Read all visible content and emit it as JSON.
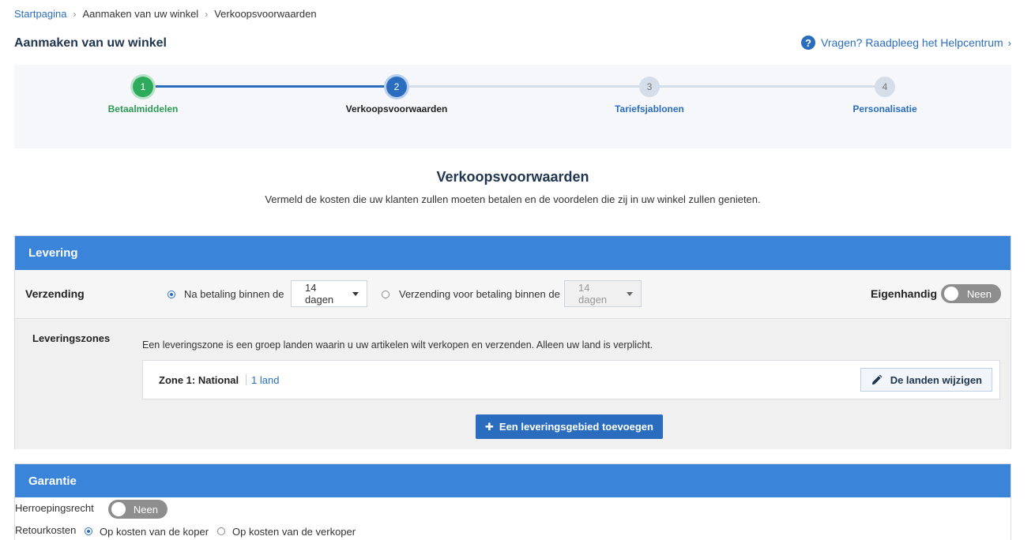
{
  "breadcrumb": {
    "home": "Startpagina",
    "sep": "›",
    "middle": "Aanmaken van uw winkel",
    "current": "Verkoopsvoorwaarden"
  },
  "header": {
    "title": "Aanmaken van uw winkel",
    "help_text": "Vragen? Raadpleeg het Helpcentrum",
    "help_icon_glyph": "?",
    "help_chevron": "›"
  },
  "stepper": {
    "steps": [
      {
        "number": "1",
        "label": "Betaalmiddelen",
        "state": "completed"
      },
      {
        "number": "2",
        "label": "Verkoopsvoorwaarden",
        "state": "active"
      },
      {
        "number": "3",
        "label": "Tariefsjablonen",
        "state": "pending"
      },
      {
        "number": "4",
        "label": "Personalisatie",
        "state": "pending"
      }
    ]
  },
  "intro": {
    "title": "Verkoopsvoorwaarden",
    "subtitle": "Vermeld de kosten die uw klanten zullen moeten betalen en de voordelen die zij in uw winkel zullen genieten."
  },
  "levering": {
    "header": "Levering",
    "verzending": {
      "label": "Verzending",
      "option1_label": "Na betaling binnen de",
      "option1_value": "14 dagen",
      "option1_selected": true,
      "option2_label": "Verzending voor betaling binnen de",
      "option2_value": "14 dagen",
      "option2_selected": false
    },
    "eigenhandig": {
      "label": "Eigenhandig",
      "toggle_text": "Neen",
      "enabled": false
    },
    "zones": {
      "label": "Leveringszones",
      "description": "Een leveringszone is een groep landen waarin u uw artikelen wilt verkopen en verzenden. Alleen uw land is verplicht.",
      "zone_name": "Zone 1: National",
      "zone_count": "1 land",
      "edit_button": "De landen wijzigen",
      "add_button": "Een leveringsgebied toevoegen",
      "add_glyph": "✚"
    }
  },
  "garantie": {
    "header": "Garantie",
    "herroeping": {
      "label": "Herroepingsrecht",
      "toggle_text": "Neen",
      "enabled": false
    },
    "retour": {
      "label": "Retourkosten",
      "option1": "Op kosten van de koper",
      "option1_selected": true,
      "option2": "Op kosten van de verkoper",
      "option2_selected": false
    }
  },
  "colors": {
    "primary": "#2a6dbf",
    "header_blue": "#3a84d9",
    "success": "#2eaa5c",
    "pending": "#d5dde8",
    "toggle_off": "#8e8e8e"
  }
}
